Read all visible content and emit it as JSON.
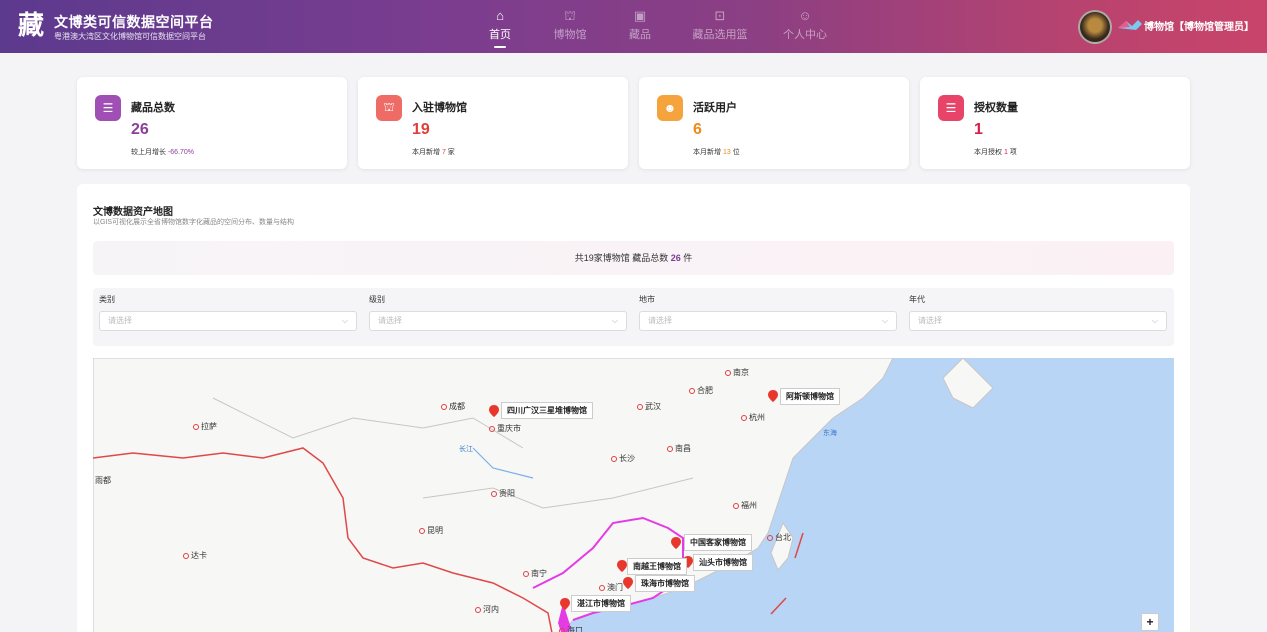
{
  "header": {
    "title": "文博类可信数据空间平台",
    "subtitle": "粤港澳大湾区文化博物馆可信数据空间平台",
    "nav": [
      {
        "label": "首页",
        "icon": "home-icon",
        "active": true
      },
      {
        "label": "博物馆",
        "icon": "museum-icon",
        "active": false
      },
      {
        "label": "藏品",
        "icon": "collection-icon",
        "active": false
      },
      {
        "label": "藏品选用篮",
        "icon": "cart-icon",
        "active": false
      },
      {
        "label": "个人中心",
        "icon": "user-icon",
        "active": false
      }
    ],
    "user": "博物馆【博物馆管理员】"
  },
  "stats": [
    {
      "label": "藏品总数",
      "value": "26",
      "note_prefix": "较上月增长 ",
      "note_value": "-66.70%",
      "note_suffix": "",
      "color": "#8e3d9c",
      "icon_bg": "#a04fb5",
      "icon": "database-icon"
    },
    {
      "label": "入驻博物馆",
      "value": "19",
      "note_prefix": "本月新增 ",
      "note_value": "7",
      "note_suffix": " 家",
      "color": "#e0403a",
      "icon_bg": "#ef6b65",
      "icon": "museum-icon"
    },
    {
      "label": "活跃用户",
      "value": "6",
      "note_prefix": "本月新增 ",
      "note_value": "13",
      "note_suffix": " 位",
      "color": "#ef8a1a",
      "icon_bg": "#f5a33c",
      "icon": "users-icon"
    },
    {
      "label": "授权数量",
      "value": "1",
      "note_prefix": "本月授权 ",
      "note_value": "1",
      "note_suffix": " 项",
      "color": "#d81e4a",
      "icon_bg": "#e8446a",
      "icon": "database-icon"
    }
  ],
  "map_section": {
    "title": "文博数据资产地图",
    "subtitle": "以GIS可视化展示全省博物馆数字化藏品的空间分布、数量与结构",
    "summary_prefix": "共19家博物馆 藏品总数 ",
    "summary_value": "26",
    "summary_suffix": " 件"
  },
  "filters": [
    {
      "label": "类别",
      "placeholder": "请选择"
    },
    {
      "label": "级别",
      "placeholder": "请选择"
    },
    {
      "label": "地市",
      "placeholder": "请选择"
    },
    {
      "label": "年代",
      "placeholder": "请选择"
    }
  ],
  "map": {
    "museums": [
      "四川广汉三星堆博物馆",
      "阿斯顿博物馆",
      "中国客家博物馆",
      "汕头市博物馆",
      "南越王博物馆",
      "珠海市博物馆",
      "湛江市博物馆"
    ],
    "cities": [
      "成都",
      "拉萨",
      "重庆市",
      "武汉",
      "合肥",
      "南京",
      "杭州",
      "长沙",
      "南昌",
      "贵阳",
      "福州",
      "昆明",
      "台北",
      "南宁",
      "澳门",
      "达卡",
      "河内",
      "海口",
      "雨都"
    ],
    "labels": {
      "east_sea": "东海",
      "yangtze": "长江"
    },
    "zoom_in": "+"
  }
}
